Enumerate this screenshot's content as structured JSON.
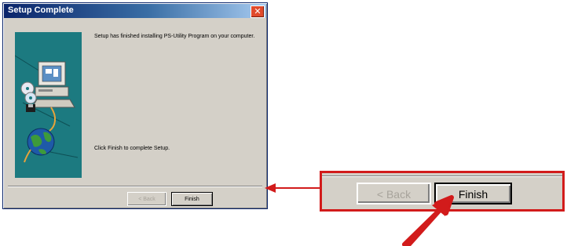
{
  "dialog": {
    "title": "Setup Complete",
    "close_label": "✕",
    "message_top": "Setup has finished installing PS-Utility Program on your computer.",
    "message_bottom": "Click Finish to complete Setup.",
    "back_label": "< Back",
    "finish_label": "Finish"
  },
  "callout": {
    "back_label": "< Back",
    "finish_label": "Finish"
  },
  "colors": {
    "title_bar": "#0a246a",
    "dialog_face": "#d4d0c8",
    "side_panel": "#1c7a80",
    "annotation_red": "#d21b1b"
  },
  "icons": {
    "close": "close-icon",
    "setup_art": "computer-globe-illustration",
    "pointer": "red-pointer-arrow",
    "connector": "connector-arrow"
  }
}
